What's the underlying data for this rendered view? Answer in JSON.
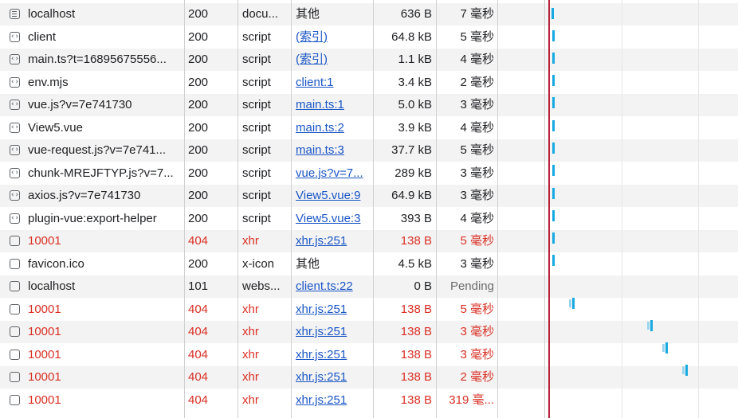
{
  "requests": [
    {
      "icon": "doc",
      "name": "localhost",
      "status": "200",
      "type": "docu...",
      "initiator": "其他",
      "initiator_link": false,
      "size": "636 B",
      "time": "7 毫秒",
      "err": false
    },
    {
      "icon": "script",
      "name": "client",
      "status": "200",
      "type": "script",
      "initiator": "(索引)",
      "initiator_link": true,
      "size": "64.8 kB",
      "time": "5 毫秒",
      "err": false
    },
    {
      "icon": "script",
      "name": "main.ts?t=16895675556...",
      "status": "200",
      "type": "script",
      "initiator": "(索引)",
      "initiator_link": true,
      "size": "1.1 kB",
      "time": "4 毫秒",
      "err": false
    },
    {
      "icon": "script",
      "name": "env.mjs",
      "status": "200",
      "type": "script",
      "initiator": "client:1",
      "initiator_link": true,
      "size": "3.4 kB",
      "time": "2 毫秒",
      "err": false
    },
    {
      "icon": "script",
      "name": "vue.js?v=7e741730",
      "status": "200",
      "type": "script",
      "initiator": "main.ts:1",
      "initiator_link": true,
      "size": "5.0 kB",
      "time": "3 毫秒",
      "err": false
    },
    {
      "icon": "script",
      "name": "View5.vue",
      "status": "200",
      "type": "script",
      "initiator": "main.ts:2",
      "initiator_link": true,
      "size": "3.9 kB",
      "time": "4 毫秒",
      "err": false
    },
    {
      "icon": "script",
      "name": "vue-request.js?v=7e741...",
      "status": "200",
      "type": "script",
      "initiator": "main.ts:3",
      "initiator_link": true,
      "size": "37.7 kB",
      "time": "5 毫秒",
      "err": false
    },
    {
      "icon": "script",
      "name": "chunk-MREJFTYP.js?v=7...",
      "status": "200",
      "type": "script",
      "initiator": "vue.js?v=7...",
      "initiator_link": true,
      "size": "289 kB",
      "time": "3 毫秒",
      "err": false
    },
    {
      "icon": "script",
      "name": "axios.js?v=7e741730",
      "status": "200",
      "type": "script",
      "initiator": "View5.vue:9",
      "initiator_link": true,
      "size": "64.9 kB",
      "time": "3 毫秒",
      "err": false
    },
    {
      "icon": "script",
      "name": "plugin-vue:export-helper",
      "status": "200",
      "type": "script",
      "initiator": "View5.vue:3",
      "initiator_link": true,
      "size": "393 B",
      "time": "4 毫秒",
      "err": false
    },
    {
      "icon": "blank",
      "name": "10001",
      "status": "404",
      "type": "xhr",
      "initiator": "xhr.js:251",
      "initiator_link": true,
      "size": "138 B",
      "time": "5 毫秒",
      "err": true
    },
    {
      "icon": "blank",
      "name": "favicon.ico",
      "status": "200",
      "type": "x-icon",
      "initiator": "其他",
      "initiator_link": false,
      "size": "4.5 kB",
      "time": "3 毫秒",
      "err": false
    },
    {
      "icon": "blank",
      "name": "localhost",
      "status": "101",
      "type": "webs...",
      "initiator": "client.ts:22",
      "initiator_link": true,
      "size": "0 B",
      "time": "Pending",
      "err": false,
      "pending": true
    },
    {
      "icon": "blank",
      "name": "10001",
      "status": "404",
      "type": "xhr",
      "initiator": "xhr.js:251",
      "initiator_link": true,
      "size": "138 B",
      "time": "5 毫秒",
      "err": true
    },
    {
      "icon": "blank",
      "name": "10001",
      "status": "404",
      "type": "xhr",
      "initiator": "xhr.js:251",
      "initiator_link": true,
      "size": "138 B",
      "time": "3 毫秒",
      "err": true
    },
    {
      "icon": "blank",
      "name": "10001",
      "status": "404",
      "type": "xhr",
      "initiator": "xhr.js:251",
      "initiator_link": true,
      "size": "138 B",
      "time": "3 毫秒",
      "err": true
    },
    {
      "icon": "blank",
      "name": "10001",
      "status": "404",
      "type": "xhr",
      "initiator": "xhr.js:251",
      "initiator_link": true,
      "size": "138 B",
      "time": "2 毫秒",
      "err": true
    },
    {
      "icon": "blank",
      "name": "10001",
      "status": "404",
      "type": "xhr",
      "initiator": "xhr.js:251",
      "initiator_link": true,
      "size": "138 B",
      "time": "319 毫...",
      "err": true
    }
  ],
  "colors": {
    "error": "#d93025",
    "link": "#1a56c5",
    "waterfall_bar": "#17a9e0",
    "load_marker": "#b3263b"
  }
}
